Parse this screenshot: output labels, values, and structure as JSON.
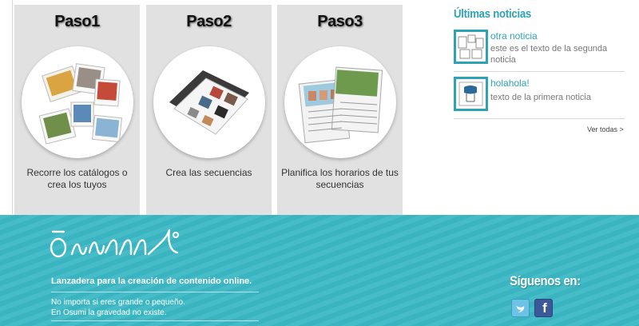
{
  "steps": [
    {
      "title": "Paso1",
      "text": "Recorre los catálogos o crea los tuyos"
    },
    {
      "title": "Paso2",
      "text": "Crea las secuencias"
    },
    {
      "title": "Paso3",
      "text": "Planifica los horarios de tus secuencias"
    }
  ],
  "news": {
    "heading": "Últimas noticias",
    "items": [
      {
        "headline": "otra noticia",
        "body": "este es el texto de la segunda noticia"
      },
      {
        "headline": "holahola!",
        "body": "texto de la primera noticia"
      }
    ],
    "view_all": "Ver todas >"
  },
  "footer": {
    "tagline": "Lanzadera para la creación de contenido online.",
    "line1": "No importa si eres grande o pequeño.",
    "line2": "En Osumi la gravedad no existe.",
    "follow": "Síguenos en:"
  },
  "icons": [
    "osumi-logo",
    "twitter-icon",
    "facebook-icon"
  ],
  "colors": {
    "accent": "#2ea3b4",
    "footer_bg": "#3bb8c4",
    "card_bg": "#e1e1e1"
  }
}
